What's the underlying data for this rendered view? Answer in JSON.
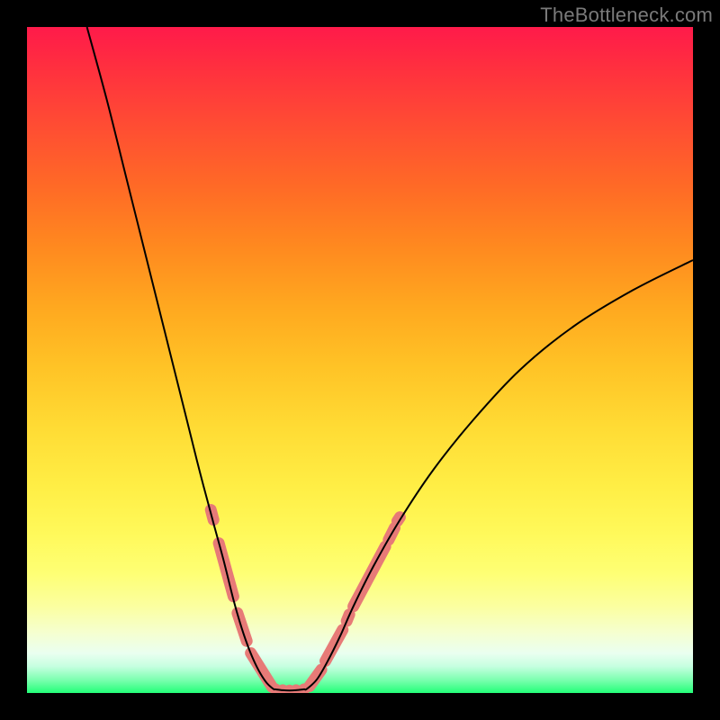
{
  "watermark": "TheBottleneck.com",
  "colors": {
    "frame": "#000000",
    "curve": "#000000",
    "markers": "#e77a77",
    "gradient_top": "#ff1a4a",
    "gradient_bottom": "#23ff78"
  },
  "chart_data": {
    "type": "line",
    "title": "",
    "xlabel": "",
    "ylabel": "",
    "xlim": [
      0,
      100
    ],
    "ylim": [
      0,
      100
    ],
    "grid": false,
    "legend": false,
    "series": [
      {
        "name": "bottleneck-curve-left",
        "x": [
          9,
          12,
          15,
          18,
          21,
          24,
          26,
          28,
          29.5,
          31,
          32,
          33,
          34,
          35,
          36,
          37
        ],
        "y": [
          100,
          89,
          77,
          65,
          53,
          41,
          33,
          25.5,
          20,
          14,
          10.5,
          7.5,
          5,
          3,
          1.5,
          0.6
        ]
      },
      {
        "name": "bottleneck-curve-right",
        "x": [
          42,
          43.5,
          45,
          47,
          49,
          52,
          56,
          61,
          67,
          74,
          82,
          91,
          100
        ],
        "y": [
          0.6,
          2,
          4.5,
          8.5,
          13,
          19,
          26,
          33.5,
          41,
          48.5,
          55,
          60.5,
          65
        ]
      }
    ],
    "markers": {
      "name": "highlighted-range-dots",
      "color": "#e77a77",
      "left_pill_segments": [
        {
          "x1": 27.6,
          "y1": 27.5,
          "x2": 28.0,
          "y2": 26.0
        },
        {
          "x1": 28.8,
          "y1": 22.5,
          "x2": 31.0,
          "y2": 14.5
        },
        {
          "x1": 31.6,
          "y1": 12.0,
          "x2": 33.0,
          "y2": 7.8
        },
        {
          "x1": 33.6,
          "y1": 6.0,
          "x2": 36.8,
          "y2": 0.9
        }
      ],
      "right_pill_segments": [
        {
          "x1": 42.4,
          "y1": 1.0,
          "x2": 44.2,
          "y2": 3.5
        },
        {
          "x1": 44.8,
          "y1": 4.8,
          "x2": 47.4,
          "y2": 9.5
        },
        {
          "x1": 48.0,
          "y1": 10.8,
          "x2": 48.4,
          "y2": 11.8
        },
        {
          "x1": 49.0,
          "y1": 13.0,
          "x2": 53.8,
          "y2": 22.0
        },
        {
          "x1": 54.3,
          "y1": 23.0,
          "x2": 55.2,
          "y2": 24.8
        },
        {
          "x1": 55.6,
          "y1": 25.8,
          "x2": 56.0,
          "y2": 26.4
        }
      ],
      "apex_dots_x": [
        37.3,
        38.4,
        39.4,
        40.4,
        41.6
      ],
      "apex_dots_y": [
        0.55,
        0.42,
        0.38,
        0.42,
        0.55
      ]
    }
  }
}
